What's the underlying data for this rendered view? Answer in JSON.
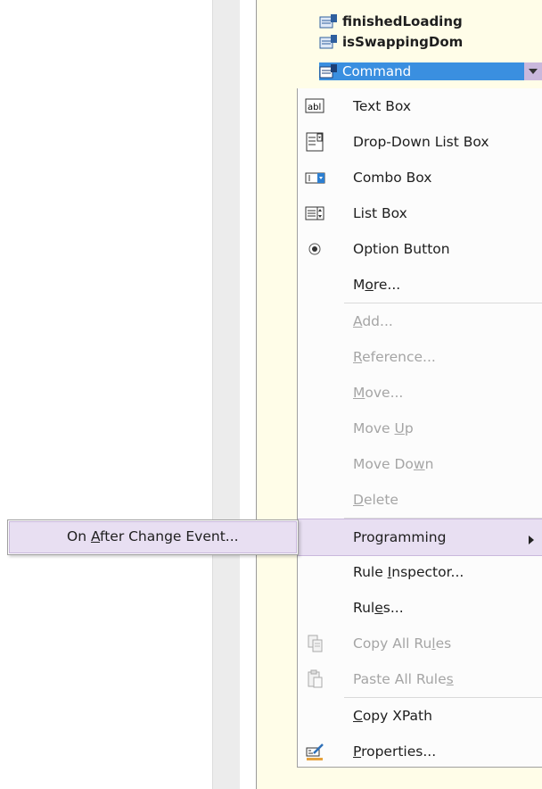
{
  "tree": {
    "items": [
      {
        "label": "finishedLoading",
        "icon": "field-attribute-icon"
      },
      {
        "label": "isSwappingDom",
        "icon": "field-attribute-icon"
      },
      {
        "label": "Command",
        "icon": "field-attribute-icon",
        "selected": true
      }
    ]
  },
  "context_menu": {
    "items": [
      {
        "label": "Text Box",
        "icon": "textbox-icon"
      },
      {
        "label": "Drop-Down List Box",
        "icon": "dropdown-list-icon"
      },
      {
        "label": "Combo Box",
        "icon": "combobox-icon"
      },
      {
        "label": "List Box",
        "icon": "listbox-icon"
      },
      {
        "label": "Option Button",
        "icon": "option-button-icon"
      },
      {
        "label_pre": "M",
        "label_u": "o",
        "label_post": "re..."
      },
      {
        "label_pre": "",
        "label_u": "A",
        "label_post": "dd..."
      },
      {
        "label_pre": "",
        "label_u": "R",
        "label_post": "eference..."
      },
      {
        "label_pre": "",
        "label_u": "M",
        "label_post": "ove..."
      },
      {
        "label_pre": "Move ",
        "label_u": "U",
        "label_post": "p"
      },
      {
        "label_pre": "Move Do",
        "label_u": "w",
        "label_post": "n"
      },
      {
        "label_pre": "",
        "label_u": "D",
        "label_post": "elete"
      },
      {
        "label": "Programming"
      },
      {
        "label_pre": "Rule ",
        "label_u": "I",
        "label_post": "nspector..."
      },
      {
        "label_pre": "Rul",
        "label_u": "e",
        "label_post": "s..."
      },
      {
        "label_pre": "Copy All Ru",
        "label_u": "l",
        "label_post": "es",
        "icon": "copy-rules-icon"
      },
      {
        "label_pre": "Paste All Rule",
        "label_u": "s",
        "label_post": "",
        "icon": "paste-rules-icon"
      },
      {
        "label_pre": "",
        "label_u": "C",
        "label_post": "opy XPath"
      },
      {
        "label_pre": "",
        "label_u": "P",
        "label_post": "roperties...",
        "icon": "properties-icon"
      }
    ]
  },
  "submenu": {
    "label_pre": "On ",
    "label_u": "A",
    "label_post": "fter Change Event..."
  },
  "colors": {
    "selection": "#3a8fe0",
    "highlight": "#e8dff2",
    "pane_background": "#fffde8",
    "disabled_text": "#a5a5a5"
  }
}
